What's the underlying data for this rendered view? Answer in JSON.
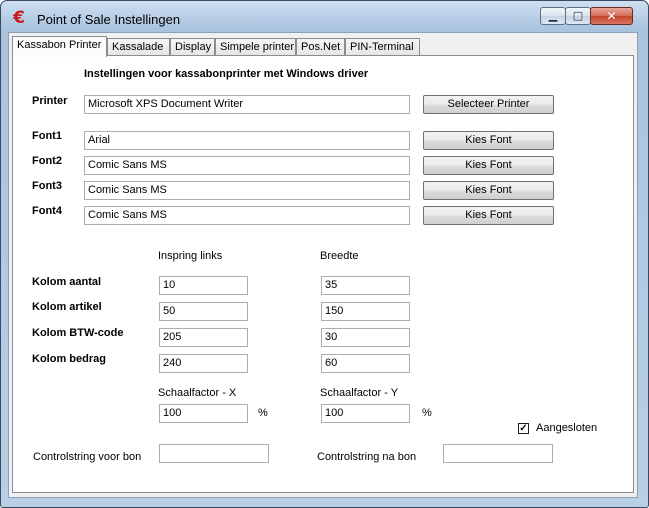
{
  "window": {
    "title": "Point of Sale Instellingen",
    "icon": "euro-icon"
  },
  "tabs": [
    "Kassabon Printer",
    "Kassalade",
    "Display",
    "Simpele printer",
    "Pos.Net",
    "PIN-Terminal"
  ],
  "heading": "Instellingen voor kassabonprinter met Windows driver",
  "printer": {
    "label": "Printer",
    "value": "Microsoft XPS Document Writer",
    "button": "Selecteer Printer"
  },
  "fonts": [
    {
      "label": "Font1",
      "value": "Arial",
      "button": "Kies Font"
    },
    {
      "label": "Font2",
      "value": "Comic Sans MS",
      "button": "Kies Font"
    },
    {
      "label": "Font3",
      "value": "Comic Sans MS",
      "button": "Kies Font"
    },
    {
      "label": "Font4",
      "value": "Comic Sans MS",
      "button": "Kies Font"
    }
  ],
  "columns": {
    "header_indent": "Inspring links",
    "header_width": "Breedte",
    "rows": [
      {
        "label": "Kolom aantal",
        "indent": "10",
        "width": "35"
      },
      {
        "label": "Kolom artikel",
        "indent": "50",
        "width": "150"
      },
      {
        "label": "Kolom BTW-code",
        "indent": "205",
        "width": "30"
      },
      {
        "label": "Kolom bedrag",
        "indent": "240",
        "width": "60"
      }
    ]
  },
  "scale": {
    "x_label": "Schaalfactor - X",
    "x_value": "100",
    "x_unit": "%",
    "y_label": "Schaalfactor - Y",
    "y_value": "100",
    "y_unit": "%"
  },
  "connected": {
    "label": "Aangesloten",
    "checked": true,
    "mark": "✓"
  },
  "control": {
    "before_label": "Controlstring voor bon",
    "before_value": "",
    "after_label": "Controlstring na bon",
    "after_value": ""
  }
}
